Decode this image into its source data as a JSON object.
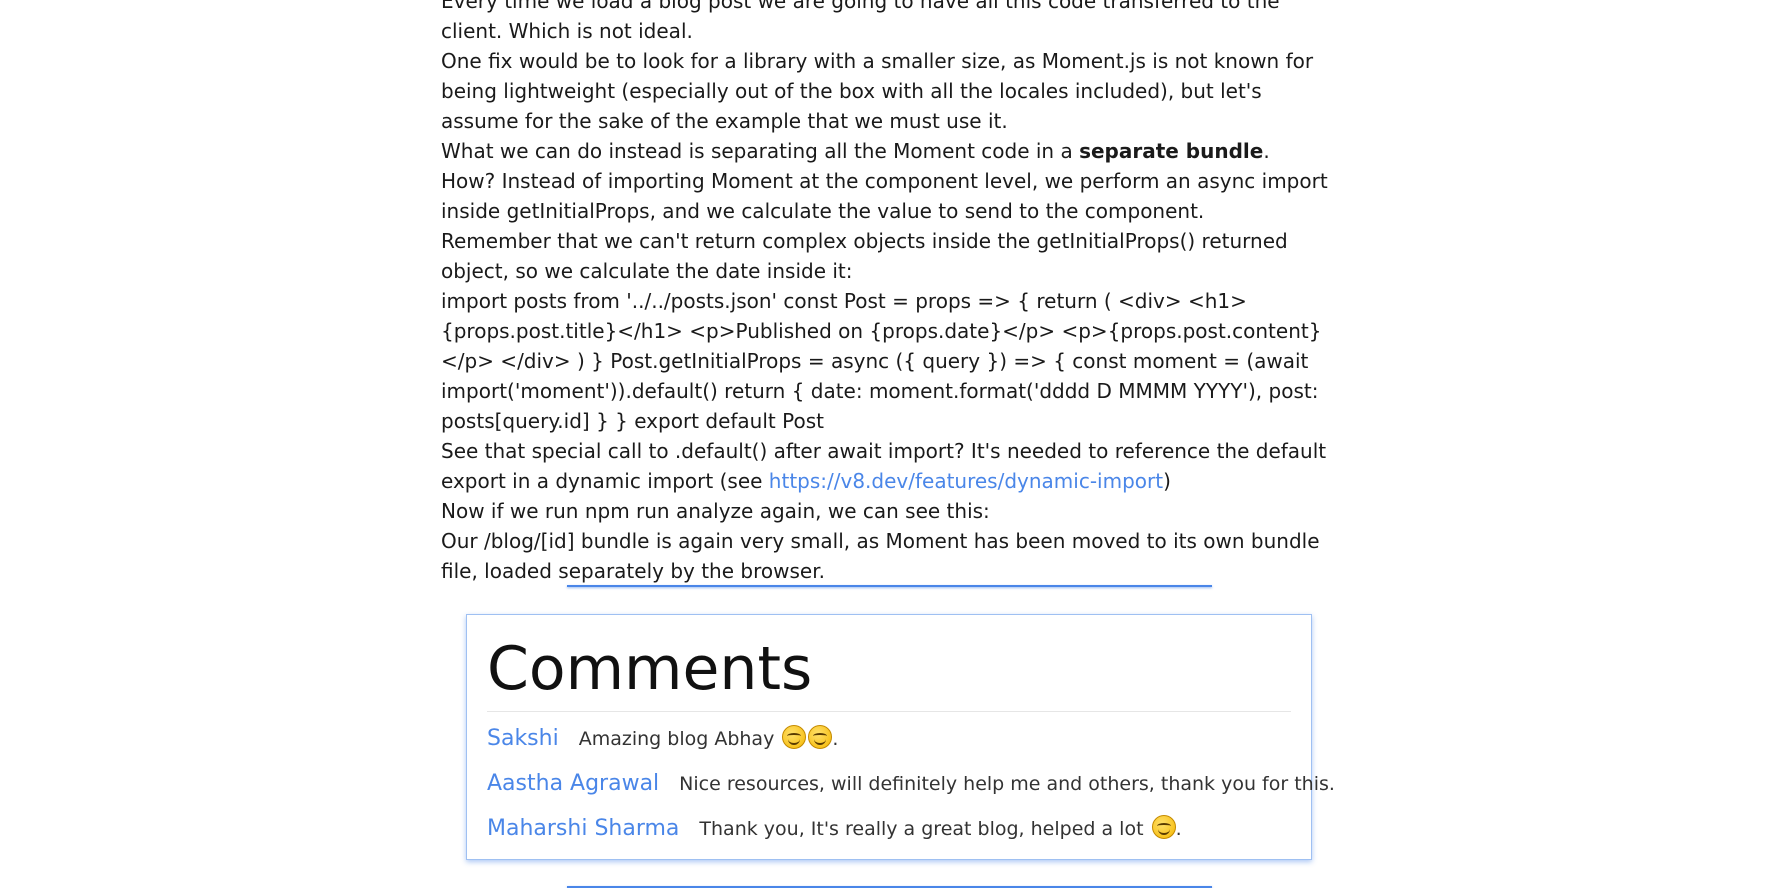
{
  "article": {
    "p0": "Every time we load a blog post we are going to have all this code transferred to the client. Which is not ideal.",
    "p1": "One fix would be to look for a library with a smaller size, as Moment.js is not known for being lightweight (especially out of the box with all the locales included), but let's assume for the sake of the example that we must use it.",
    "p2_before": "What we can do instead is separating all the Moment code in a ",
    "p2_bold": "separate bundle",
    "p2_after": ".",
    "p3": "How? Instead of importing Moment at the component level, we perform an async import inside getInitialProps, and we calculate the value to send to the component.",
    "p4": "Remember that we can't return complex objects inside the getInitialProps() returned object, so we calculate the date inside it:",
    "code": "import posts from '../../posts.json' const Post = props => { return ( <div> <h1>{props.post.title}</h1> <p>Published on {props.date}</p> <p>{props.post.content}</p> </div> ) } Post.getInitialProps = async ({ query }) => { const moment = (await import('moment')).default() return { date: moment.format('dddd D MMMM YYYY'), post: posts[query.id] } } export default Post",
    "p5_before": "See that special call to .default() after await import? It's needed to reference the default export in a dynamic import (see ",
    "p5_link": "https://v8.dev/features/dynamic-import",
    "p5_after": ")",
    "p6": "Now if we run npm run analyze again, we can see this:",
    "p7": "Our /blog/[id] bundle is again very small, as Moment has been moved to its own bundle file, loaded separately by the browser."
  },
  "comments": {
    "title": "Comments",
    "items": [
      {
        "author": "Sakshi",
        "text": "Amazing blog Abhay ",
        "emojis": [
          "smiling-face-icon",
          "smiling-face-icon"
        ],
        "suffix": "."
      },
      {
        "author": "Aastha Agrawal",
        "text": "Nice resources, will definitely help me and others, thank you for this.",
        "emojis": [],
        "suffix": ""
      },
      {
        "author": "Maharshi Sharma",
        "text": "Thank you, It's really a great blog, helped a lot ",
        "emojis": [
          "smiling-face-icon"
        ],
        "suffix": "."
      }
    ]
  },
  "colors": {
    "link": "#4a86e8",
    "divider": "#4a86e8"
  }
}
